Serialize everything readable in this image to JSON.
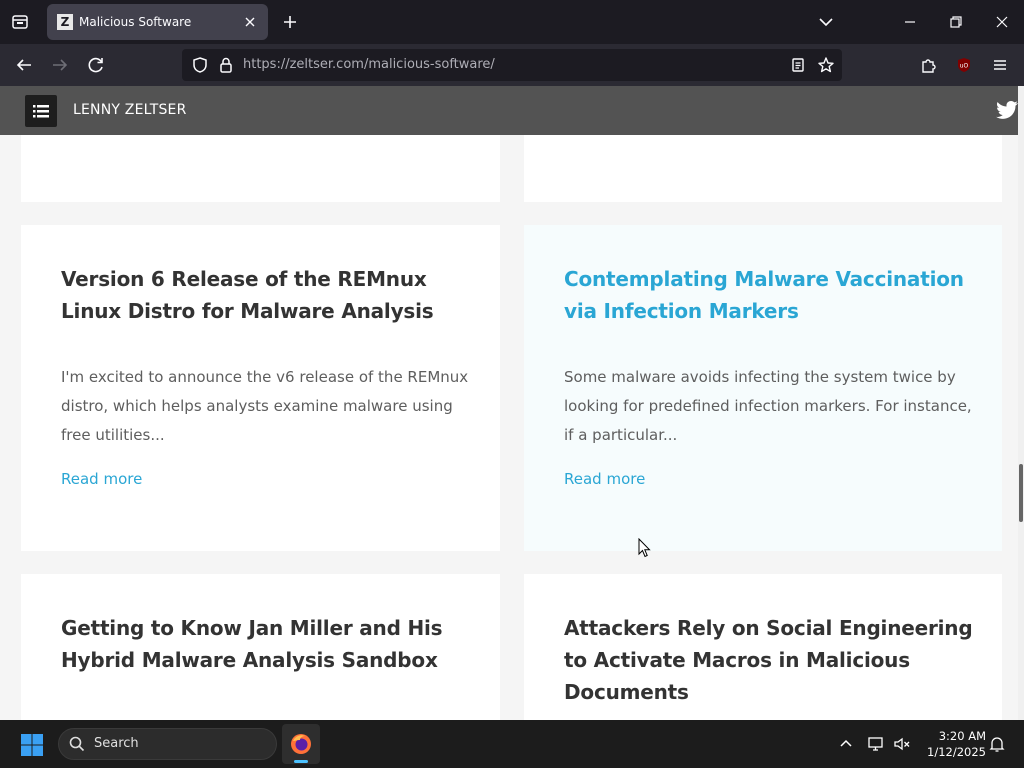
{
  "browser": {
    "tab_title": "Malicious Software",
    "favicon_letter": "Z",
    "url_host": "https://zeltser.com",
    "url_path": "/malicious-software/"
  },
  "site": {
    "name": "LENNY ZELTSER"
  },
  "cards": [
    {
      "title": "Version 6 Release of the REMnux Linux Distro for Malware Analysis",
      "excerpt": "I'm excited to announce the v6 release of the REMnux distro, which helps analysts examine malware using free utilities...",
      "read_more": "Read more"
    },
    {
      "title": "Contemplating Malware Vaccination via Infection Markers",
      "excerpt": "Some malware avoids infecting the system twice by looking for predefined infection markers. For instance, if a particular...",
      "read_more": "Read more"
    },
    {
      "title": "Getting to Know Jan Miller and His Hybrid Malware Analysis Sandbox"
    },
    {
      "title": "Attackers Rely on Social Engineering to Activate Macros in Malicious Documents"
    }
  ],
  "taskbar": {
    "search_label": "Search",
    "time": "3:20 AM",
    "date": "1/12/2025"
  },
  "colors": {
    "accent": "#2aa6d4",
    "heading": "#333333",
    "body_text": "#5e5e5e"
  }
}
